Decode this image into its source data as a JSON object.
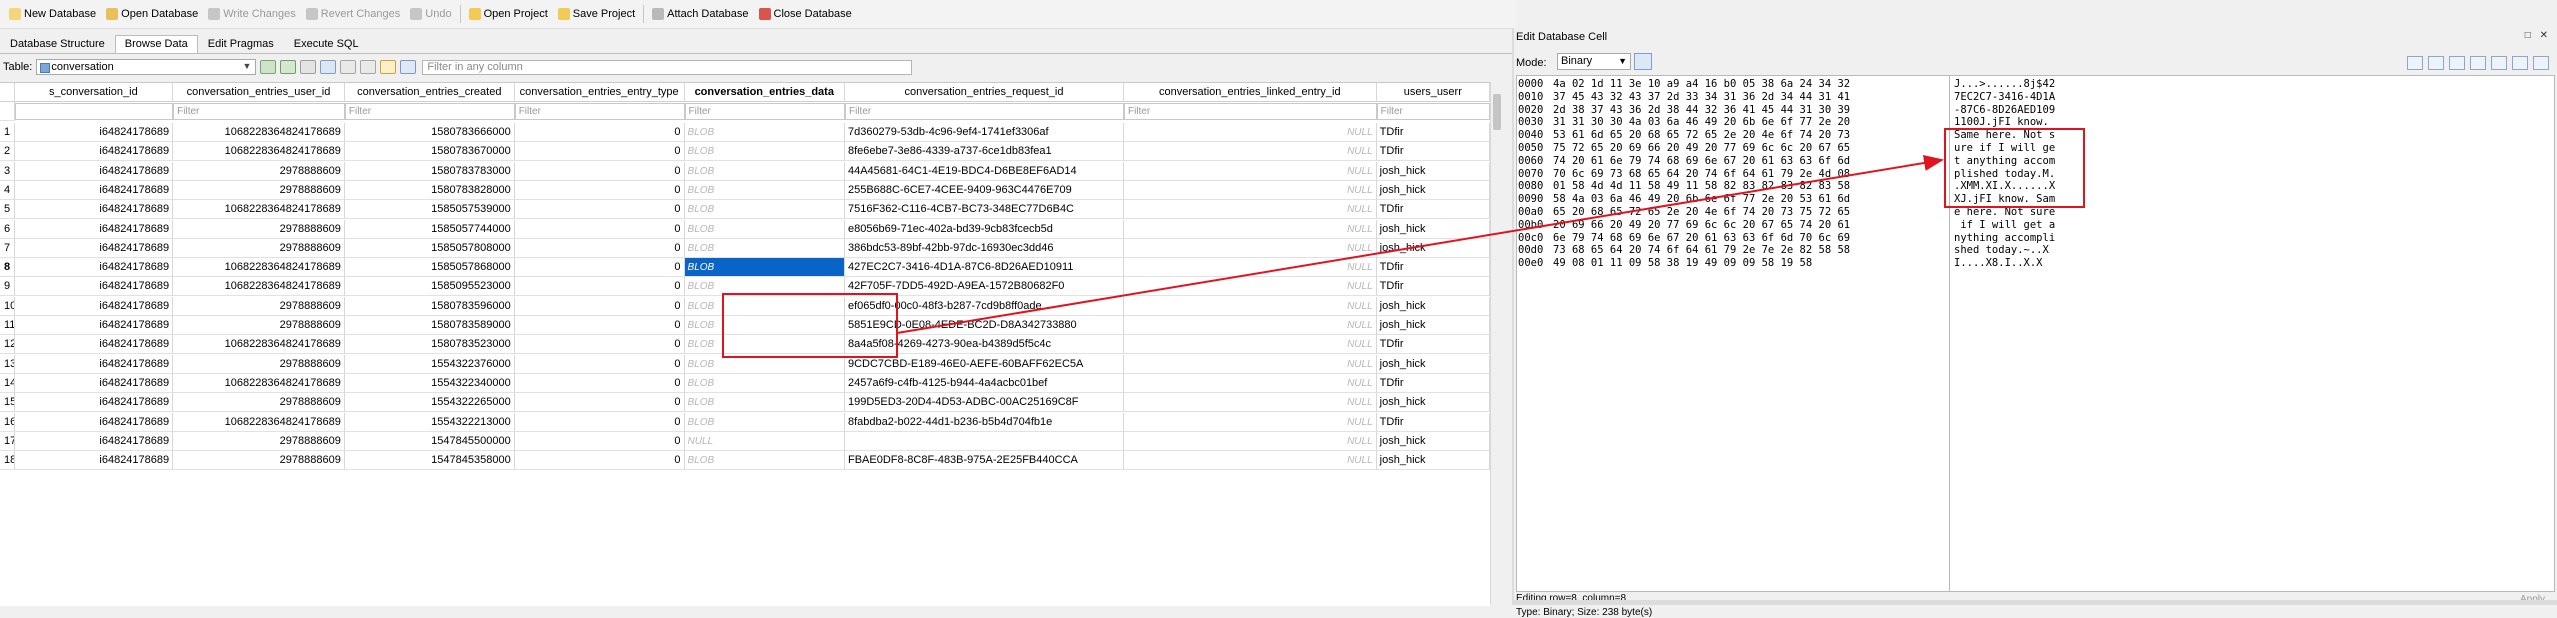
{
  "toolbar": {
    "buttons": [
      {
        "label": "New Database",
        "enabled": true
      },
      {
        "label": "Open Database",
        "enabled": true
      },
      {
        "label": "Write Changes",
        "enabled": false
      },
      {
        "label": "Revert Changes",
        "enabled": false
      },
      {
        "label": "Undo",
        "enabled": false
      },
      {
        "label": "Open Project",
        "enabled": true
      },
      {
        "label": "Save Project",
        "enabled": true
      },
      {
        "label": "Attach Database",
        "enabled": true
      },
      {
        "label": "Close Database",
        "enabled": true
      }
    ]
  },
  "tabs": [
    "Database Structure",
    "Browse Data",
    "Edit Pragmas",
    "Execute SQL"
  ],
  "active_tab": "Browse Data",
  "table_bar": {
    "label": "Table:",
    "selected_table": "conversation",
    "filter_placeholder": "Filter in any column"
  },
  "grid": {
    "columns": [
      {
        "label": "s_conversation_id",
        "bold": false
      },
      {
        "label": "conversation_entries_user_id",
        "bold": false
      },
      {
        "label": "conversation_entries_created",
        "bold": false
      },
      {
        "label": "conversation_entries_entry_type",
        "bold": false
      },
      {
        "label": "conversation_entries_data",
        "bold": true
      },
      {
        "label": "conversation_entries_request_id",
        "bold": false
      },
      {
        "label": "conversation_entries_linked_entry_id",
        "bold": false
      },
      {
        "label": "users_userr",
        "bold": false
      }
    ],
    "filter_placeholder": "Filter",
    "rows": [
      {
        "n": "1",
        "c0": "i64824178689",
        "c1": "1068228364824178689",
        "c2": "1580783666000",
        "c3": "0",
        "c4": "BLOB",
        "c5": "7d360279-53db-4c96-9ef4-1741ef3306af",
        "c6": "NULL",
        "c7": "TDfir"
      },
      {
        "n": "2",
        "c0": "i64824178689",
        "c1": "1068228364824178689",
        "c2": "1580783670000",
        "c3": "0",
        "c4": "BLOB",
        "c5": "8fe6ebe7-3e86-4339-a737-6ce1db83fea1",
        "c6": "NULL",
        "c7": "TDfir"
      },
      {
        "n": "3",
        "c0": "i64824178689",
        "c1": "2978888609",
        "c2": "1580783783000",
        "c3": "0",
        "c4": "BLOB",
        "c5": "44A45681-64C1-4E19-BDC4-D6BE8EF6AD14",
        "c6": "NULL",
        "c7": "josh_hick"
      },
      {
        "n": "4",
        "c0": "i64824178689",
        "c1": "2978888609",
        "c2": "1580783828000",
        "c3": "0",
        "c4": "BLOB",
        "c5": "255B688C-6CE7-4CEE-9409-963C4476E709",
        "c6": "NULL",
        "c7": "josh_hick"
      },
      {
        "n": "5",
        "c0": "i64824178689",
        "c1": "1068228364824178689",
        "c2": "1585057539000",
        "c3": "0",
        "c4": "BLOB",
        "c5": "7516F362-C116-4CB7-BC73-348EC77D6B4C",
        "c6": "NULL",
        "c7": "TDfir"
      },
      {
        "n": "6",
        "c0": "i64824178689",
        "c1": "2978888609",
        "c2": "1585057744000",
        "c3": "0",
        "c4": "BLOB",
        "c5": "e8056b69-71ec-402a-bd39-9cb83fcecb5d",
        "c6": "NULL",
        "c7": "josh_hick"
      },
      {
        "n": "7",
        "c0": "i64824178689",
        "c1": "2978888609",
        "c2": "1585057808000",
        "c3": "0",
        "c4": "BLOB",
        "c5": "386bdc53-89bf-42bb-97dc-16930ec3dd46",
        "c6": "NULL",
        "c7": "josh_hick"
      },
      {
        "n": "8",
        "c0": "i64824178689",
        "c1": "1068228364824178689",
        "c2": "1585057868000",
        "c3": "0",
        "c4": "BLOB",
        "c5": "427EC2C7-3416-4D1A-87C6-8D26AED10911",
        "c6": "NULL",
        "c7": "TDfir"
      },
      {
        "n": "9",
        "c0": "i64824178689",
        "c1": "1068228364824178689",
        "c2": "1585095523000",
        "c3": "0",
        "c4": "BLOB",
        "c5": "42F705F-7DD5-492D-A9EA-1572B80682F0",
        "c6": "NULL",
        "c7": "TDfir"
      },
      {
        "n": "10",
        "c0": "i64824178689",
        "c1": "2978888609",
        "c2": "1580783596000",
        "c3": "0",
        "c4": "BLOB",
        "c5": "ef065df0-00c0-48f3-b287-7cd9b8ff0ade",
        "c6": "NULL",
        "c7": "josh_hick"
      },
      {
        "n": "11",
        "c0": "i64824178689",
        "c1": "2978888609",
        "c2": "1580783589000",
        "c3": "0",
        "c4": "BLOB",
        "c5": "5851E9CD-0E08-4EDE-BC2D-D8A342733880",
        "c6": "NULL",
        "c7": "josh_hick"
      },
      {
        "n": "12",
        "c0": "i64824178689",
        "c1": "1068228364824178689",
        "c2": "1580783523000",
        "c3": "0",
        "c4": "BLOB",
        "c5": "8a4a5f08-4269-4273-90ea-b4389d5f5c4c",
        "c6": "NULL",
        "c7": "TDfir"
      },
      {
        "n": "13",
        "c0": "i64824178689",
        "c1": "2978888609",
        "c2": "1554322376000",
        "c3": "0",
        "c4": "BLOB",
        "c5": "9CDC7CBD-E189-46E0-AEFE-60BAFF62EC5A",
        "c6": "NULL",
        "c7": "josh_hick"
      },
      {
        "n": "14",
        "c0": "i64824178689",
        "c1": "1068228364824178689",
        "c2": "1554322340000",
        "c3": "0",
        "c4": "BLOB",
        "c5": "2457a6f9-c4fb-4125-b944-4a4acbc01bef",
        "c6": "NULL",
        "c7": "TDfir"
      },
      {
        "n": "15",
        "c0": "i64824178689",
        "c1": "2978888609",
        "c2": "1554322265000",
        "c3": "0",
        "c4": "BLOB",
        "c5": "199D5ED3-20D4-4D53-ADBC-00AC25169C8F",
        "c6": "NULL",
        "c7": "josh_hick"
      },
      {
        "n": "16",
        "c0": "i64824178689",
        "c1": "1068228364824178689",
        "c2": "1554322213000",
        "c3": "0",
        "c4": "BLOB",
        "c5": "8fabdba2-b022-44d1-b236-b5b4d704fb1e",
        "c6": "NULL",
        "c7": "TDfir"
      },
      {
        "n": "17",
        "c0": "i64824178689",
        "c1": "2978888609",
        "c2": "1547845500000",
        "c3": "0",
        "c4": "NULL",
        "c5": "",
        "c6": "NULL",
        "c7": "josh_hick"
      },
      {
        "n": "18",
        "c0": "i64824178689",
        "c1": "2978888609",
        "c2": "1547845358000",
        "c3": "0",
        "c4": "BLOB",
        "c5": "FBAE0DF8-8C8F-483B-975A-2E25FB440CCA",
        "c6": "NULL",
        "c7": "josh_hick"
      }
    ],
    "selected_row": "8",
    "selected_column": "conversation_entries_data"
  },
  "edit_panel": {
    "title": "Edit Database Cell",
    "mode_label": "Mode:",
    "mode_value": "Binary",
    "hex_lines": [
      {
        "addr": "0000",
        "bytes": "4a 02 1d 11 3e 10 a9 a4 16 b0 05 38 6a 24 34 32",
        "ascii": "J...>......8j$42"
      },
      {
        "addr": "0010",
        "bytes": "37 45 43 32 43 37 2d 33 34 31 36 2d 34 44 31 41",
        "ascii": "7EC2C7-3416-4D1A"
      },
      {
        "addr": "0020",
        "bytes": "2d 38 37 43 36 2d 38 44 32 36 41 45 44 31 30 39",
        "ascii": "-87C6-8D26AED109"
      },
      {
        "addr": "0030",
        "bytes": "31 31 30 30 4a 03 6a 46 49 20 6b 6e 6f 77 2e 20",
        "ascii": "1100J.jFI know. "
      },
      {
        "addr": "0040",
        "bytes": "53 61 6d 65 20 68 65 72 65 2e 20 4e 6f 74 20 73",
        "ascii": "Same here. Not s"
      },
      {
        "addr": "0050",
        "bytes": "75 72 65 20 69 66 20 49 20 77 69 6c 6c 20 67 65",
        "ascii": "ure if I will ge"
      },
      {
        "addr": "0060",
        "bytes": "74 20 61 6e 79 74 68 69 6e 67 20 61 63 63 6f 6d",
        "ascii": "t anything accom"
      },
      {
        "addr": "0070",
        "bytes": "70 6c 69 73 68 65 64 20 74 6f 64 61 79 2e 4d 08",
        "ascii": "plished today.M."
      },
      {
        "addr": "0080",
        "bytes": "01 58 4d 4d 11 58 49 11 58 82 83 82 83 82 83 58",
        "ascii": ".XMM.XI.X......X"
      },
      {
        "addr": "0090",
        "bytes": "58 4a 03 6a 46 49 20 6b 6e 6f 77 2e 20 53 61 6d",
        "ascii": "XJ.jFI know. Sam"
      },
      {
        "addr": "00a0",
        "bytes": "65 20 68 65 72 65 2e 20 4e 6f 74 20 73 75 72 65",
        "ascii": "e here. Not sure"
      },
      {
        "addr": "00b0",
        "bytes": "20 69 66 20 49 20 77 69 6c 6c 20 67 65 74 20 61",
        "ascii": " if I will get a"
      },
      {
        "addr": "00c0",
        "bytes": "6e 79 74 68 69 6e 67 20 61 63 63 6f 6d 70 6c 69",
        "ascii": "nything accompli"
      },
      {
        "addr": "00d0",
        "bytes": "73 68 65 64 20 74 6f 64 61 79 2e 7e 2e 82 58 58",
        "ascii": "shed today.~..X"
      },
      {
        "addr": "00e0",
        "bytes": "49 08 01 11 09 58 38 19 49 09 09 58 19 58",
        "ascii": "I....X8.I..X.X"
      }
    ],
    "status_line1": "Editing row=8, column=8",
    "status_line2": "Type: Binary; Size: 238 byte(s)",
    "apply_label": "Apply"
  },
  "annotation_color": "#e0141e",
  "colors": {
    "selection": "#0a64c8"
  }
}
